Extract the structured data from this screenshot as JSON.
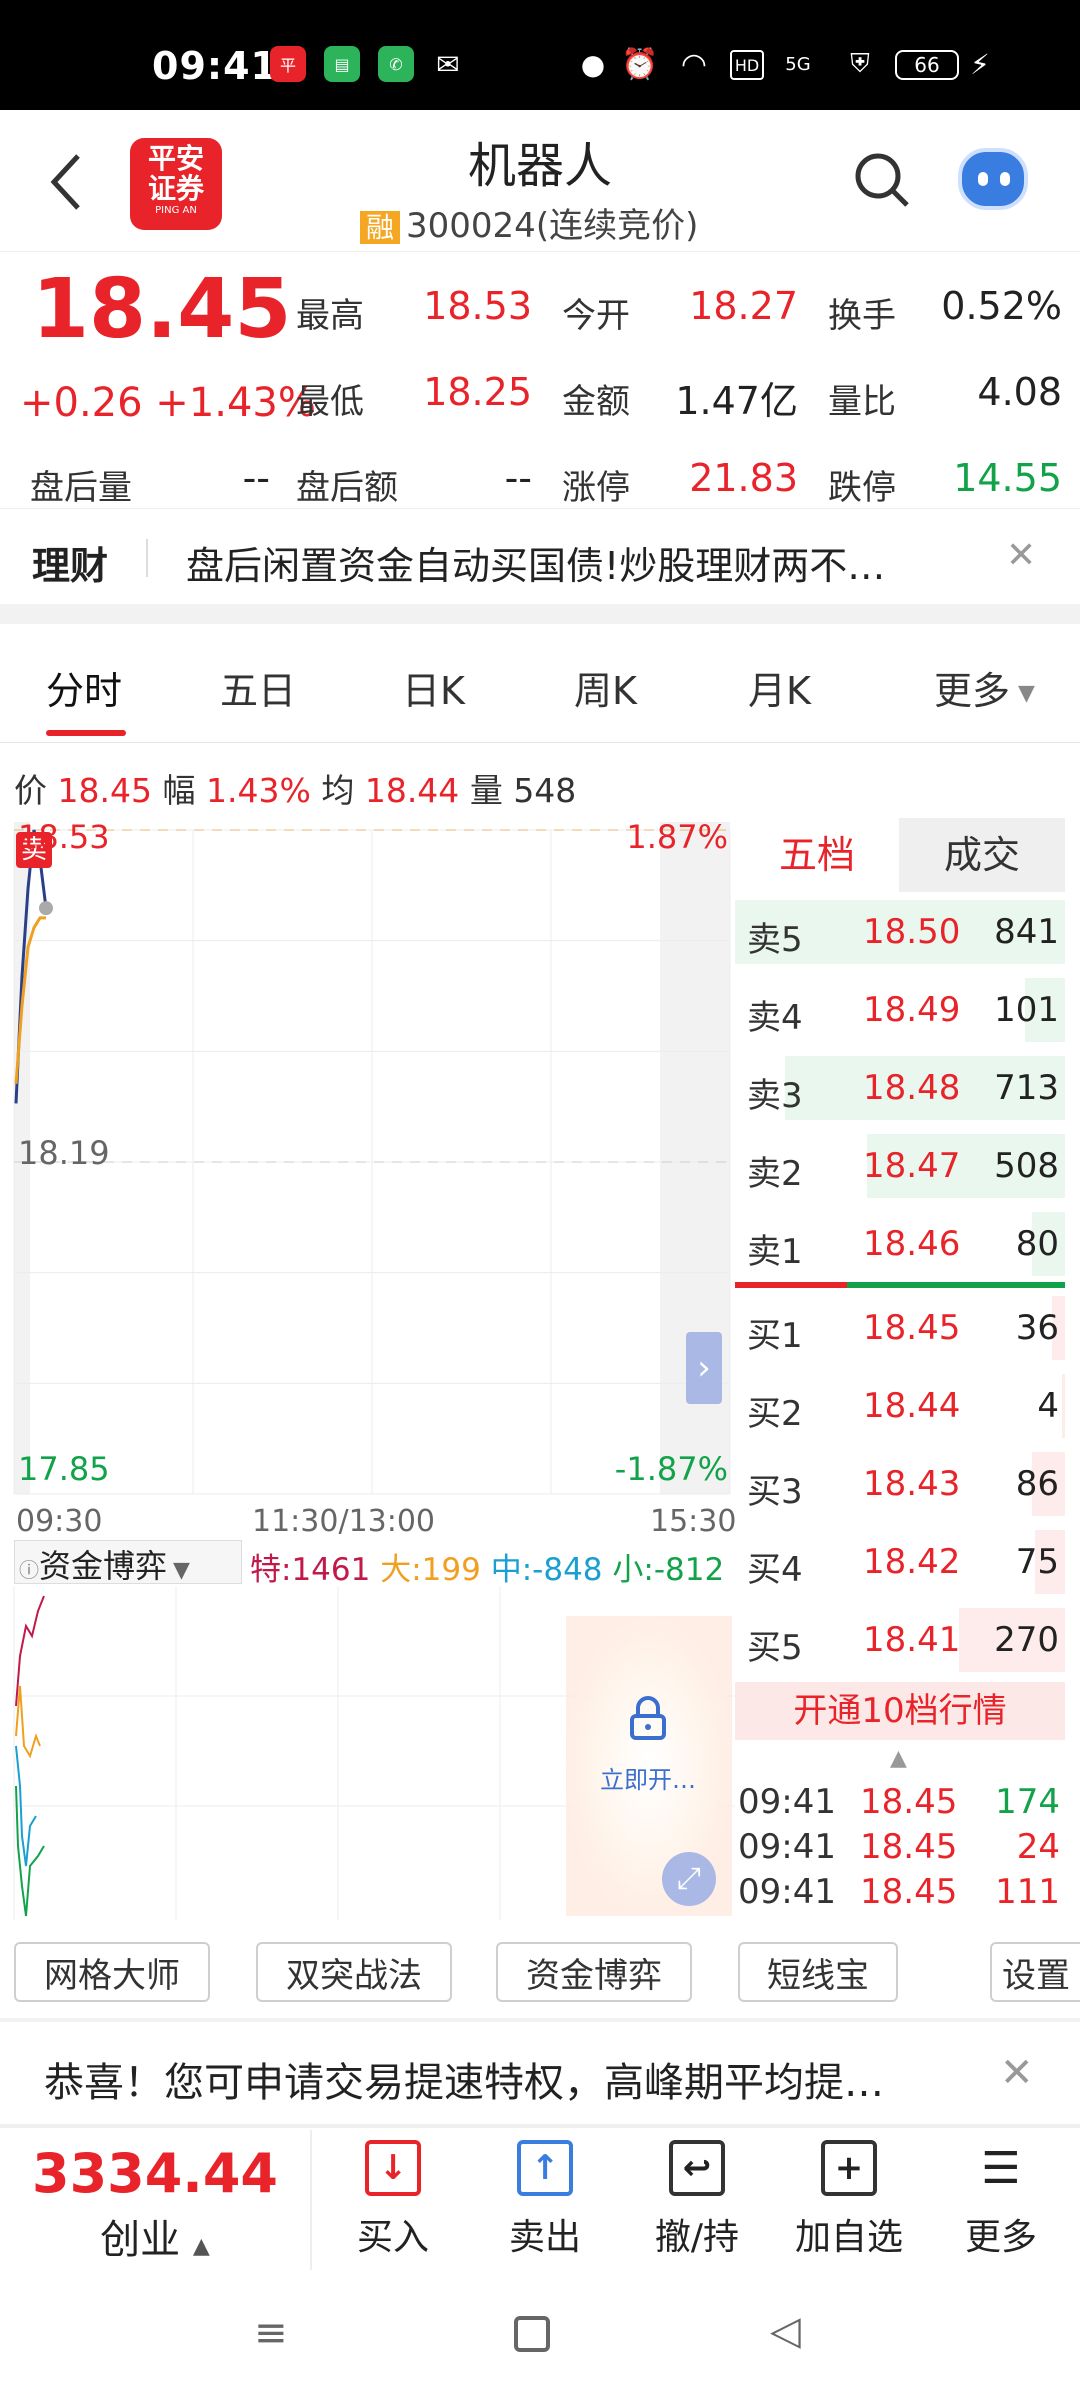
{
  "status_bar": {
    "time": "09:41",
    "battery": "66",
    "network": "5G",
    "hd": "HD"
  },
  "header": {
    "title": "机器人",
    "tag": "融",
    "code": "300024",
    "state": "(连续竞价)",
    "logo_line1": "平安",
    "logo_line2": "证券",
    "logo_sub": "PING AN"
  },
  "quote": {
    "price": "18.45",
    "change": "+0.26",
    "change_pct": "+1.43%",
    "high_label": "最高",
    "high": "18.53",
    "open_label": "今开",
    "open": "18.27",
    "turnover_label": "换手",
    "turnover": "0.52%",
    "low_label": "最低",
    "low": "18.25",
    "amount_label": "金额",
    "amount": "1.47亿",
    "vol_ratio_label": "量比",
    "vol_ratio": "4.08",
    "ah_vol_label": "盘后量",
    "ah_vol": "--",
    "ah_amt_label": "盘后额",
    "ah_amt": "--",
    "limit_up_label": "涨停",
    "limit_up": "21.83",
    "limit_down_label": "跌停",
    "limit_down": "14.55"
  },
  "banner": {
    "label": "理财",
    "text": "盘后闲置资金自动买国债!炒股理财两不…",
    "close": "✕"
  },
  "tabs": [
    "分时",
    "五日",
    "日K",
    "周K",
    "月K",
    "更多"
  ],
  "chart_info": {
    "price_label": "价",
    "price": "18.45",
    "range_label": "幅",
    "range": "1.43%",
    "avg_label": "均",
    "avg": "18.44",
    "vol_label": "量",
    "vol": "548",
    "sell_marker": "卖"
  },
  "chart_data": {
    "type": "line",
    "ylim": [
      17.85,
      18.53
    ],
    "y_tick_labels": [
      "18.53",
      "18.19",
      "17.85"
    ],
    "pct_labels": [
      "1.87%",
      "-1.87%"
    ],
    "x_tick_labels": [
      "09:30",
      "11:30/13:00",
      "15:30"
    ],
    "series": [
      {
        "name": "价",
        "values": [
          18.25,
          18.38,
          18.47,
          18.53,
          18.5,
          18.45
        ]
      },
      {
        "name": "均",
        "values": [
          18.27,
          18.35,
          18.41,
          18.43,
          18.44,
          18.44
        ]
      }
    ]
  },
  "fund": {
    "selector": "资金博弈",
    "special_label": "特",
    "special": "1461",
    "large_label": "大",
    "large": "199",
    "mid_label": "中",
    "mid": "-848",
    "small_label": "小",
    "small": "-812",
    "lock_text": "立即开…"
  },
  "order_book": {
    "tab_active": "五档",
    "tab_other": "成交",
    "asks": [
      {
        "label": "卖5",
        "price": "18.50",
        "vol": "841",
        "bar": 1.0
      },
      {
        "label": "卖4",
        "price": "18.49",
        "vol": "101",
        "bar": 0.12
      },
      {
        "label": "卖3",
        "price": "18.48",
        "vol": "713",
        "bar": 0.85
      },
      {
        "label": "卖2",
        "price": "18.47",
        "vol": "508",
        "bar": 0.6
      },
      {
        "label": "卖1",
        "price": "18.46",
        "vol": "80",
        "bar": 0.1
      }
    ],
    "bids": [
      {
        "label": "买1",
        "price": "18.45",
        "vol": "36",
        "bar": 0.04
      },
      {
        "label": "买2",
        "price": "18.44",
        "vol": "4",
        "bar": 0.01
      },
      {
        "label": "买3",
        "price": "18.43",
        "vol": "86",
        "bar": 0.1
      },
      {
        "label": "买4",
        "price": "18.42",
        "vol": "75",
        "bar": 0.09
      },
      {
        "label": "买5",
        "price": "18.41",
        "vol": "270",
        "bar": 0.32
      }
    ],
    "upgrade": "开通10档行情",
    "ticks": [
      {
        "time": "09:41",
        "price": "18.45",
        "vol": "174",
        "dir": "up"
      },
      {
        "time": "09:41",
        "price": "18.45",
        "vol": "24",
        "dir": "down"
      },
      {
        "time": "09:41",
        "price": "18.45",
        "vol": "111",
        "dir": "down"
      }
    ]
  },
  "tools": [
    "网格大师",
    "双突战法",
    "资金博弈",
    "短线宝",
    "设置"
  ],
  "notice": {
    "text": "恭喜！您可申请交易提速特权，高峰期平均提…",
    "close": "✕"
  },
  "bottom_bar": {
    "index_value": "3334.44",
    "index_name": "创业",
    "buttons": [
      "买入",
      "卖出",
      "撤/持",
      "加自选",
      "更多"
    ]
  },
  "colors": {
    "up": "#e8242a",
    "down": "#12a34a",
    "accent": "#e8242a",
    "avg_line": "#f0a020",
    "price_line": "#2a3f8a"
  }
}
